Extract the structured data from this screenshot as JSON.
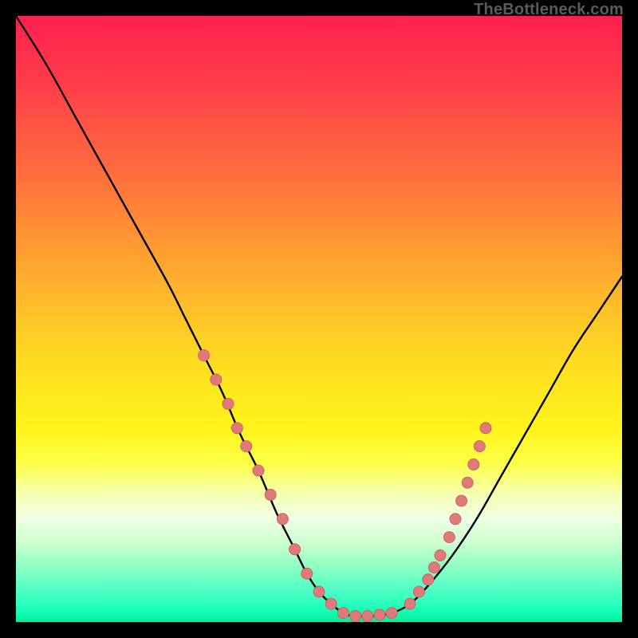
{
  "watermark": "TheBottleneck.com",
  "chart_data": {
    "type": "line",
    "title": "",
    "xlabel": "",
    "ylabel": "",
    "xlim": [
      0,
      100
    ],
    "ylim": [
      0,
      100
    ],
    "series": [
      {
        "name": "bottleneck-curve",
        "x": [
          0,
          5,
          10,
          15,
          20,
          25,
          28,
          31,
          34,
          37,
          40,
          43,
          46,
          48,
          50,
          52,
          54,
          56,
          59,
          62,
          65,
          68,
          72,
          76,
          80,
          84,
          88,
          92,
          96,
          100
        ],
        "y": [
          100,
          92,
          83,
          74,
          65,
          56,
          50,
          44,
          38,
          31,
          25,
          18,
          12,
          8,
          5,
          3,
          1.5,
          1,
          1,
          1.5,
          3,
          6,
          11,
          17,
          24,
          31,
          38,
          45,
          51,
          57
        ]
      }
    ],
    "markers": [
      {
        "name": "left-cluster-1",
        "x": 31,
        "y": 44
      },
      {
        "name": "left-cluster-2",
        "x": 33,
        "y": 40
      },
      {
        "name": "left-cluster-3",
        "x": 35,
        "y": 36
      },
      {
        "name": "left-cluster-4",
        "x": 36.5,
        "y": 32
      },
      {
        "name": "left-cluster-5",
        "x": 38,
        "y": 29
      },
      {
        "name": "left-cluster-6",
        "x": 40,
        "y": 25
      },
      {
        "name": "left-cluster-7",
        "x": 42,
        "y": 21
      },
      {
        "name": "left-cluster-8",
        "x": 44,
        "y": 17
      },
      {
        "name": "left-cluster-9",
        "x": 46,
        "y": 12
      },
      {
        "name": "left-cluster-10",
        "x": 48,
        "y": 8
      },
      {
        "name": "left-cluster-11",
        "x": 50,
        "y": 5
      },
      {
        "name": "left-cluster-12",
        "x": 52,
        "y": 3
      },
      {
        "name": "bottom-1",
        "x": 54,
        "y": 1.5
      },
      {
        "name": "bottom-2",
        "x": 56,
        "y": 1
      },
      {
        "name": "bottom-3",
        "x": 58,
        "y": 1
      },
      {
        "name": "bottom-4",
        "x": 60,
        "y": 1.2
      },
      {
        "name": "bottom-5",
        "x": 62,
        "y": 1.5
      },
      {
        "name": "right-cluster-1",
        "x": 65,
        "y": 3
      },
      {
        "name": "right-cluster-2",
        "x": 66.5,
        "y": 5
      },
      {
        "name": "right-cluster-3",
        "x": 68,
        "y": 7
      },
      {
        "name": "right-cluster-4",
        "x": 69,
        "y": 9
      },
      {
        "name": "right-cluster-5",
        "x": 70,
        "y": 11
      },
      {
        "name": "right-cluster-6",
        "x": 71.5,
        "y": 14
      },
      {
        "name": "right-cluster-7",
        "x": 72.5,
        "y": 17
      },
      {
        "name": "right-cluster-8",
        "x": 73.5,
        "y": 20
      },
      {
        "name": "right-cluster-9",
        "x": 74.5,
        "y": 23
      },
      {
        "name": "right-cluster-10",
        "x": 75.5,
        "y": 26
      },
      {
        "name": "right-cluster-11",
        "x": 76.5,
        "y": 29
      },
      {
        "name": "right-cluster-12",
        "x": 77.5,
        "y": 32
      }
    ],
    "colors": {
      "curve": "#000000",
      "marker_fill": "#e07a7a",
      "marker_stroke": "#c96464"
    }
  }
}
